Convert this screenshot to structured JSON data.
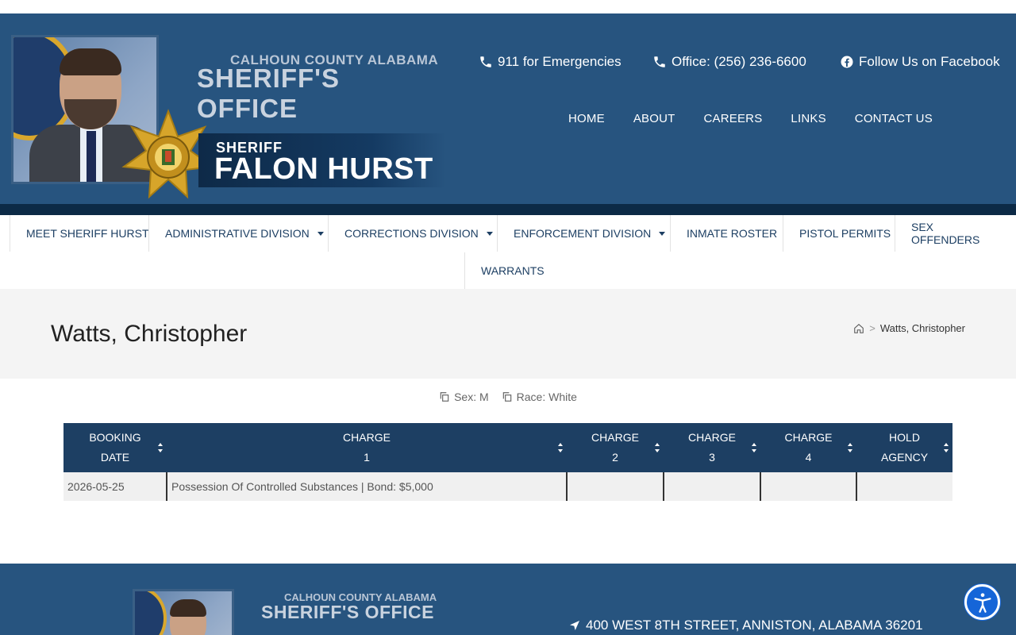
{
  "header": {
    "office_small": "CALHOUN COUNTY ALABAMA",
    "office_big": "SHERIFF'S OFFICE",
    "sheriff_label": "SHERIFF",
    "sheriff_name": "FALON HURST",
    "emergency": "911 for Emergencies",
    "office_phone": "Office: (256) 236-6600",
    "facebook": "Follow Us on Facebook",
    "top_nav": [
      "HOME",
      "ABOUT",
      "CAREERS",
      "LINKS",
      "CONTACT US"
    ]
  },
  "main_menu": [
    {
      "label": "MEET SHERIFF HURST",
      "dropdown": false
    },
    {
      "label": "ADMINISTRATIVE DIVISION",
      "dropdown": true
    },
    {
      "label": "CORRECTIONS DIVISION",
      "dropdown": true
    },
    {
      "label": "ENFORCEMENT DIVISION",
      "dropdown": true
    },
    {
      "label": "INMATE ROSTER",
      "dropdown": false
    },
    {
      "label": "PISTOL PERMITS",
      "dropdown": false
    },
    {
      "label": "SEX OFFENDERS",
      "dropdown": false
    },
    {
      "label": "WARRANTS",
      "dropdown": false
    }
  ],
  "page": {
    "title": "Watts, Christopher",
    "breadcrumb_current": "Watts, Christopher"
  },
  "meta": {
    "sex": "Sex: M",
    "race": "Race: White"
  },
  "table": {
    "headers": [
      [
        "BOOKING",
        "DATE"
      ],
      [
        "CHARGE",
        "1"
      ],
      [
        "CHARGE",
        "2"
      ],
      [
        "CHARGE",
        "3"
      ],
      [
        "CHARGE",
        "4"
      ],
      [
        "HOLD",
        "AGENCY"
      ]
    ],
    "rows": [
      [
        "2026-05-25",
        "Possession Of Controlled Substances | Bond: $5,000",
        "",
        "",
        "",
        ""
      ]
    ]
  },
  "footer": {
    "office_small": "CALHOUN COUNTY ALABAMA",
    "office_big": "SHERIFF'S OFFICE",
    "address": "400 WEST 8TH STREET, ANNISTON, ALABAMA 36201"
  },
  "colors": {
    "header_blue": "#27547f",
    "dark_navy": "#0c2a46",
    "table_header": "#1d3f63",
    "accessibility_button": "#1565d8"
  }
}
